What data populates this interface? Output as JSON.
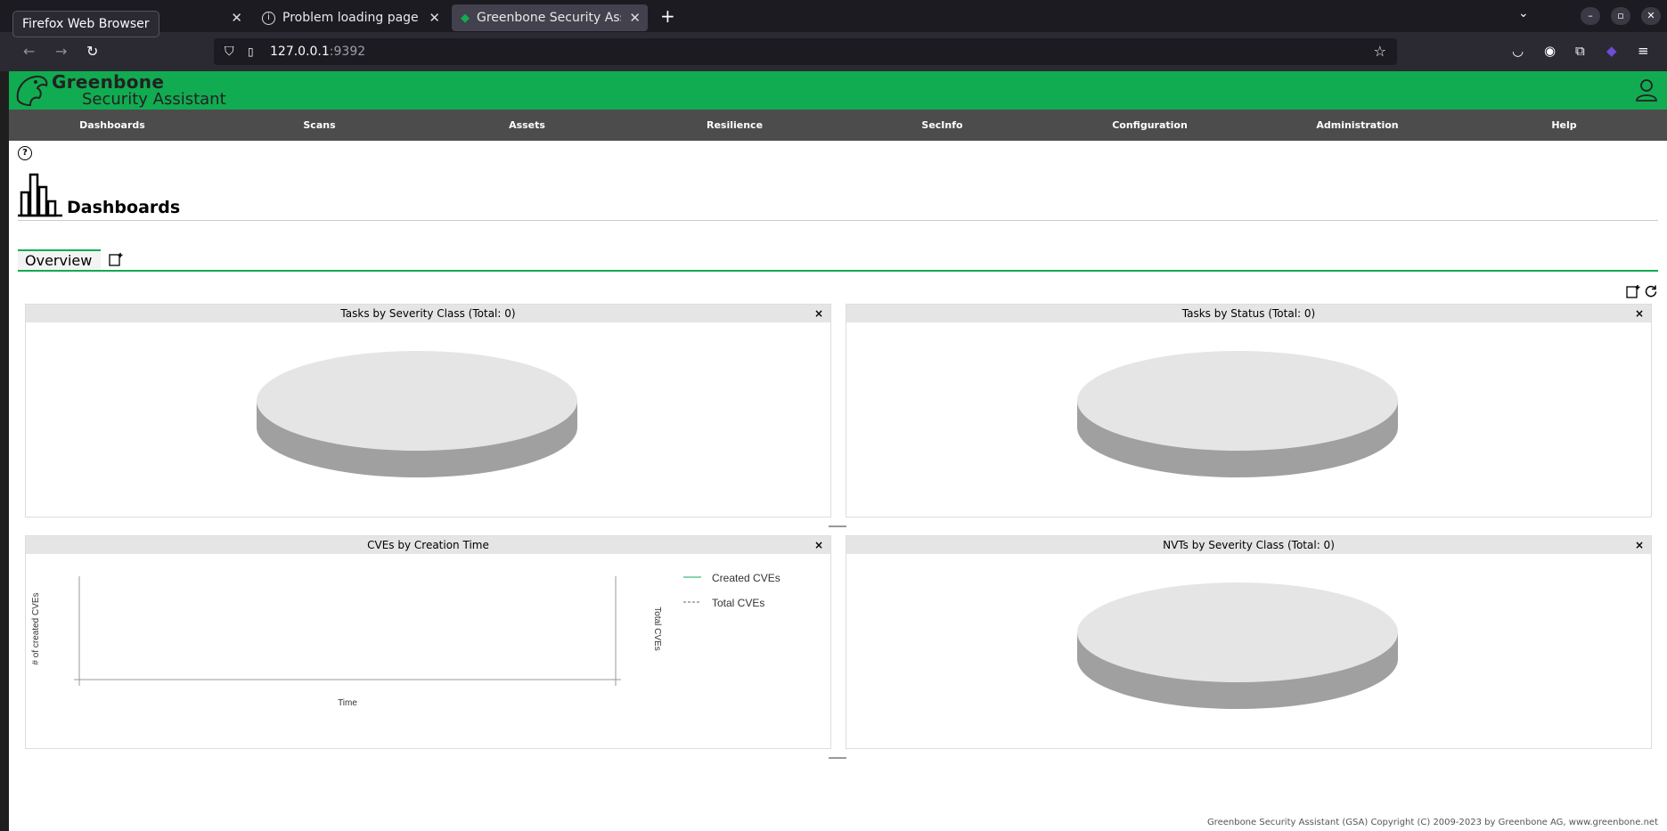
{
  "browser": {
    "tooltip": "Firefox Web Browser",
    "tabs": [
      {
        "title": ""
      },
      {
        "title": "Problem loading page"
      },
      {
        "title": "Greenbone Security Assis"
      }
    ],
    "url_host": "127.0.0.1",
    "url_port": ":9392"
  },
  "app": {
    "logo_line1": "Greenbone",
    "logo_line2": "Security Assistant",
    "menu": [
      "Dashboards",
      "Scans",
      "Assets",
      "Resilience",
      "SecInfo",
      "Configuration",
      "Administration",
      "Help"
    ],
    "page_title": "Dashboards",
    "tab_overview": "Overview",
    "help_glyph": "?"
  },
  "panels": [
    {
      "title": "Tasks by Severity Class (Total: 0)"
    },
    {
      "title": "Tasks by Status (Total: 0)"
    },
    {
      "title": "CVEs by Creation Time"
    },
    {
      "title": "NVTs by Severity Class (Total: 0)"
    }
  ],
  "chart_data": [
    {
      "type": "pie",
      "title": "Tasks by Severity Class (Total: 0)",
      "values": []
    },
    {
      "type": "pie",
      "title": "Tasks by Status (Total: 0)",
      "values": []
    },
    {
      "type": "line",
      "title": "CVEs by Creation Time",
      "xlabel": "Time",
      "ylabel": "# of created CVEs",
      "y2label": "Total CVEs",
      "series": [
        {
          "name": "Created CVEs",
          "values": []
        },
        {
          "name": "Total CVEs",
          "values": []
        }
      ]
    },
    {
      "type": "pie",
      "title": "NVTs by Severity Class (Total: 0)",
      "values": []
    }
  ],
  "footer": "Greenbone Security Assistant (GSA) Copyright (C) 2009-2023 by Greenbone AG, www.greenbone.net",
  "colors": {
    "brand": "#11ab51",
    "menu_bg": "#4c4c4c",
    "pie_top": "#e5e5e5",
    "pie_side": "#a0a0a0"
  }
}
